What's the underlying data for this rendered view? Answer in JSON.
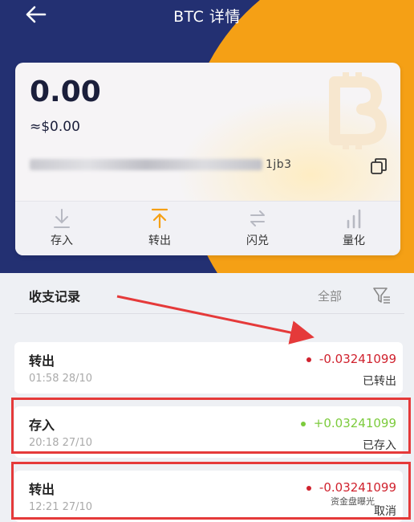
{
  "header": {
    "title": "BTC 详情"
  },
  "wallet": {
    "balance": "0.00",
    "usd": "≈$0.00",
    "address_tail": "1jb3"
  },
  "actions": [
    {
      "label": "存入",
      "icon": "deposit-icon"
    },
    {
      "label": "转出",
      "icon": "withdraw-icon"
    },
    {
      "label": "闪兑",
      "icon": "swap-icon"
    },
    {
      "label": "量化",
      "icon": "chart-icon"
    }
  ],
  "records": {
    "title": "收支记录",
    "filter_all": "全部",
    "items": [
      {
        "type": "转出",
        "time": "01:58 28/10",
        "amount": "-0.03241099",
        "status": "已转出",
        "color": "#d0222e"
      },
      {
        "type": "存入",
        "time": "20:18 27/10",
        "amount": "+0.03241099",
        "status": "已存入",
        "color": "#7ccb3c"
      },
      {
        "type": "转出",
        "time": "12:21 27/10",
        "amount": "-0.03241099",
        "status": "取消",
        "color": "#d0222e"
      }
    ]
  },
  "colors": {
    "navy": "#233072",
    "orange": "#f5a015",
    "accent": "#f5a015",
    "highlight": "#e53a3a"
  },
  "watermark": "资金盘曝光"
}
